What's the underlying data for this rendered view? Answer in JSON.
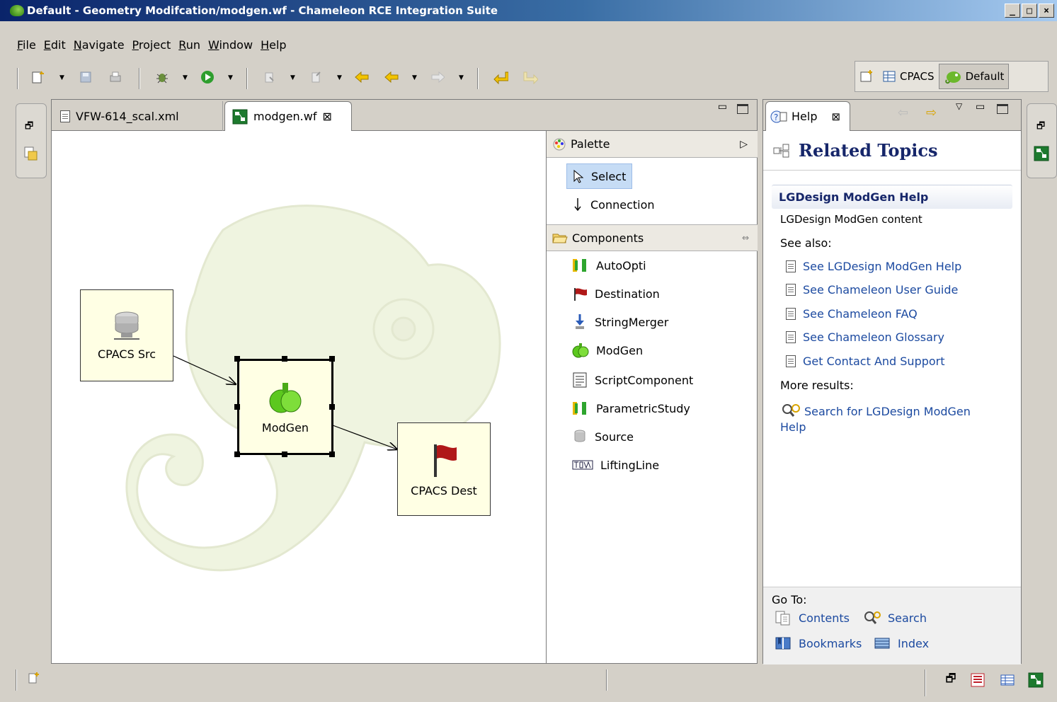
{
  "window": {
    "title": "Default - Geometry Modifcation/modgen.wf - Chameleon RCE Integration Suite",
    "minimize": "_",
    "maximize": "□",
    "close": "×"
  },
  "menu": [
    {
      "label": "File",
      "u": "F",
      "rest": "ile"
    },
    {
      "label": "Edit",
      "u": "E",
      "rest": "dit"
    },
    {
      "label": "Navigate",
      "u": "N",
      "rest": "avigate"
    },
    {
      "label": "Project",
      "u": "P",
      "rest": "roject"
    },
    {
      "label": "Run",
      "u": "R",
      "rest": "un"
    },
    {
      "label": "Window",
      "u": "W",
      "rest": "indow"
    },
    {
      "label": "Help",
      "u": "H",
      "rest": "elp"
    }
  ],
  "perspectives": {
    "cpacs": "CPACS",
    "default": "Default"
  },
  "editor": {
    "tabs": [
      {
        "label": "VFW-614_scal.xml"
      },
      {
        "label": "modgen.wf",
        "close": "⊠"
      }
    ],
    "nodes": {
      "src": "CPACS Src",
      "modgen": "ModGen",
      "dest": "CPACS Dest"
    }
  },
  "palette": {
    "title": "Palette",
    "tools": [
      {
        "label": "Select"
      },
      {
        "label": "Connection"
      }
    ],
    "components_title": "Components",
    "components": [
      {
        "label": "AutoOpti"
      },
      {
        "label": "Destination"
      },
      {
        "label": "StringMerger"
      },
      {
        "label": "ModGen"
      },
      {
        "label": "ScriptComponent"
      },
      {
        "label": "ParametricStudy"
      },
      {
        "label": "Source"
      },
      {
        "label": "LiftingLine"
      }
    ]
  },
  "help": {
    "tab": "Help",
    "heading": "Related Topics",
    "section_title": "LGDesign ModGen Help",
    "content": "LGDesign ModGen content",
    "see_also": "See also:",
    "links": [
      "See LGDesign ModGen  Help",
      "See Chameleon User Guide",
      "See Chameleon FAQ",
      "See Chameleon Glossary",
      "Get Contact And Support"
    ],
    "more_results": "More results:",
    "search_result": "Search for LGDesign ModGen Help",
    "goto_label": "Go To:",
    "goto": {
      "contents": "Contents",
      "search": "Search",
      "bookmarks": "Bookmarks",
      "index": "Index"
    }
  }
}
